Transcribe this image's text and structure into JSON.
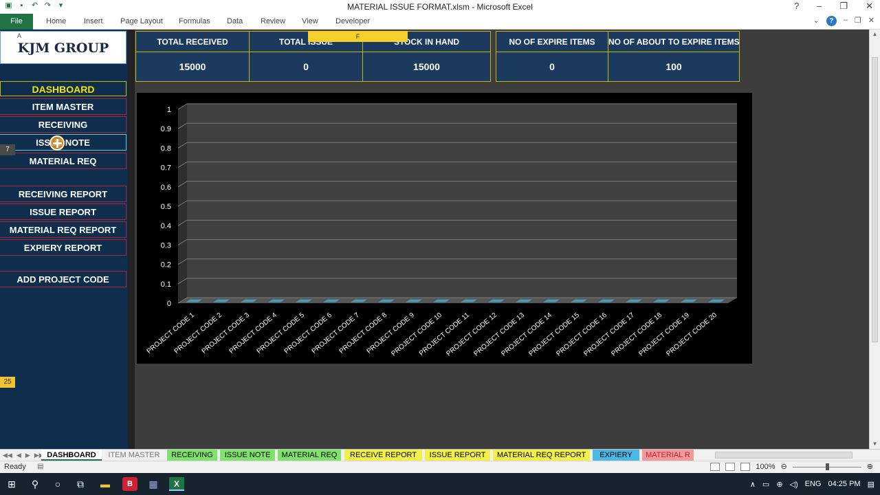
{
  "window": {
    "title": "MATERIAL ISSUE FORMAT.xlsm  -  Microsoft Excel"
  },
  "ribbon": {
    "file": "File",
    "tabs": [
      "Home",
      "Insert",
      "Page Layout",
      "Formulas",
      "Data",
      "Review",
      "View",
      "Developer"
    ]
  },
  "sidebar": {
    "logo": "KJM GROUP",
    "logo_corner": "A",
    "dashboard": "DASHBOARD",
    "buttons": [
      "ITEM MASTER",
      "RECEIVING",
      "ISSUE NOTE",
      "MATERIAL REQ"
    ],
    "report_buttons": [
      "RECEIVING REPORT",
      "ISSUE REPORT",
      "MATERIAL REQ REPORT",
      "EXPIERY REPORT"
    ],
    "project_button": "ADD PROJECT CODE",
    "cell_tag_1": "7",
    "cell_tag_2": "25"
  },
  "kpis": {
    "group1": [
      {
        "label": "TOTAL RECEIVED",
        "value": "15000"
      },
      {
        "label": "TOTAL ISSUE",
        "value": "0"
      },
      {
        "label": "STOCK IN HAND",
        "value": "15000"
      }
    ],
    "group2": [
      {
        "label": "NO OF EXPIRE ITEMS",
        "value": "0"
      },
      {
        "label": "NO OF ABOUT TO EXPIRE ITEMS",
        "value": "100"
      }
    ],
    "tooltip": "F"
  },
  "chart_data": {
    "type": "bar",
    "categories": [
      "PROJECT CODE 1",
      "PROJECT CODE 2",
      "PROJECT CODE 3",
      "PROJECT CODE 4",
      "PROJECT CODE 5",
      "PROJECT CODE 6",
      "PROJECT CODE 7",
      "PROJECT CODE 8",
      "PROJECT CODE 9",
      "PROJECT CODE 10",
      "PROJECT CODE 11",
      "PROJECT CODE 12",
      "PROJECT CODE 13",
      "PROJECT CODE 14",
      "PROJECT CODE 15",
      "PROJECT CODE 16",
      "PROJECT CODE 17",
      "PROJECT CODE 18",
      "PROJECT CODE 19",
      "PROJECT CODE 20"
    ],
    "values": [
      0,
      0,
      0,
      0,
      0,
      0,
      0,
      0,
      0,
      0,
      0,
      0,
      0,
      0,
      0,
      0,
      0,
      0,
      0,
      0
    ],
    "yticks": [
      "0",
      "0.1",
      "0.2",
      "0.3",
      "0.4",
      "0.5",
      "0.6",
      "0.7",
      "0.8",
      "0.9",
      "1"
    ],
    "ylim": [
      0,
      1
    ],
    "grid": true,
    "title": "",
    "xlabel": "",
    "ylabel": "",
    "bar_color": "#4a9bb8"
  },
  "sheet_tabs": [
    {
      "label": "DASHBOARD",
      "color": "#ffffff"
    },
    {
      "label": "ITEM MASTER",
      "color": "#f0f0f0"
    },
    {
      "label": "RECEIVING",
      "color": "#7fe36b"
    },
    {
      "label": "ISSUE NOTE",
      "color": "#7fe36b"
    },
    {
      "label": "MATERIAL REQ",
      "color": "#7fe36b"
    },
    {
      "label": "RECEIVE REPORT",
      "color": "#f3f04a"
    },
    {
      "label": "ISSUE REPORT",
      "color": "#f3f04a"
    },
    {
      "label": "MATERIAL REQ REPORT",
      "color": "#f3f04a"
    },
    {
      "label": "EXPIERY",
      "color": "#4cb8e6"
    },
    {
      "label": "MATERIAL R",
      "color": "#f29a9a"
    }
  ],
  "status": {
    "ready": "Ready",
    "zoom": "100%"
  },
  "taskbar": {
    "lang": "ENG",
    "time": "04:25 PM"
  }
}
